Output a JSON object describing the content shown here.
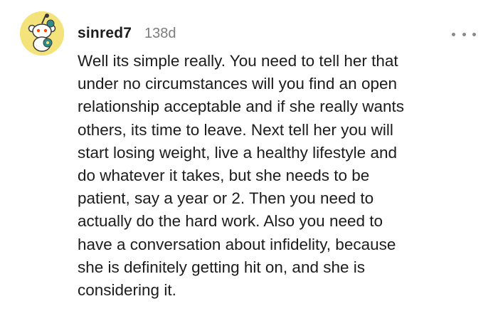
{
  "comment": {
    "avatar_icon": "reddit-snoo-avatar-icon",
    "avatar_bg": "#f4e27a",
    "username": "sinred7",
    "timestamp": "138d",
    "more_icon": "more-options-icon",
    "body": "Well its simple really. You need to tell her that\nunder no circumstances will you find an open\nrelationship acceptable and if she really wants\nothers, its time to leave. Next tell her you will\nstart losing weight, live a healthy lifestyle and\ndo whatever it takes, but she needs to be\npatient, say a year or 2. Then you need to\nactually do the hard work. Also you need to\nhave a conversation about infidelity, because\nshe is definitely getting hit on, and she is\nconsidering it."
  }
}
